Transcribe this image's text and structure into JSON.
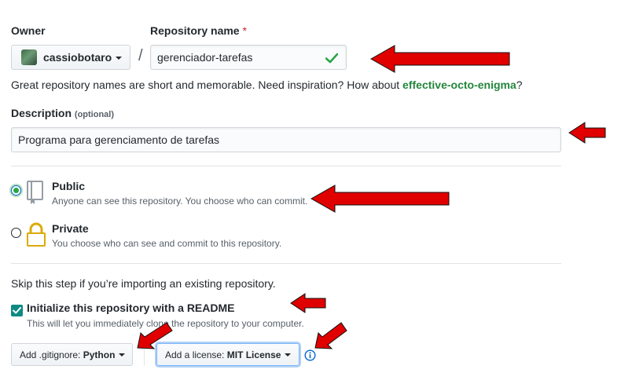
{
  "owner": {
    "label": "Owner",
    "username": "cassiobotaro"
  },
  "repo": {
    "label": "Repository name",
    "required_mark": "*",
    "separator": "/",
    "value": "gerenciador-tarefas",
    "hint_prefix": "Great repository names are short and memorable. Need inspiration? How about ",
    "suggestion": "effective-octo-enigma",
    "hint_suffix": "?"
  },
  "description": {
    "label": "Description",
    "optional": "(optional)",
    "value": "Programa para gerenciamento de tarefas"
  },
  "visibility": {
    "public_title": "Public",
    "public_desc": "Anyone can see this repository. You choose who can commit.",
    "private_title": "Private",
    "private_desc": "You choose who can see and commit to this repository.",
    "selected": "public"
  },
  "init": {
    "skip_text": "Skip this step if you’re importing an existing repository.",
    "readme_label": "Initialize this repository with a README",
    "readme_desc": "This will let you immediately clone the repository to your computer.",
    "readme_checked": true
  },
  "gitignore": {
    "prefix": "Add .gitignore:",
    "value": "Python"
  },
  "license": {
    "prefix": "Add a license:",
    "value": "MIT License"
  },
  "colors": {
    "accent_green": "#28a745",
    "link_green": "#22863a",
    "annotation_red": "#e00000",
    "focus_blue": "#0366d6"
  }
}
